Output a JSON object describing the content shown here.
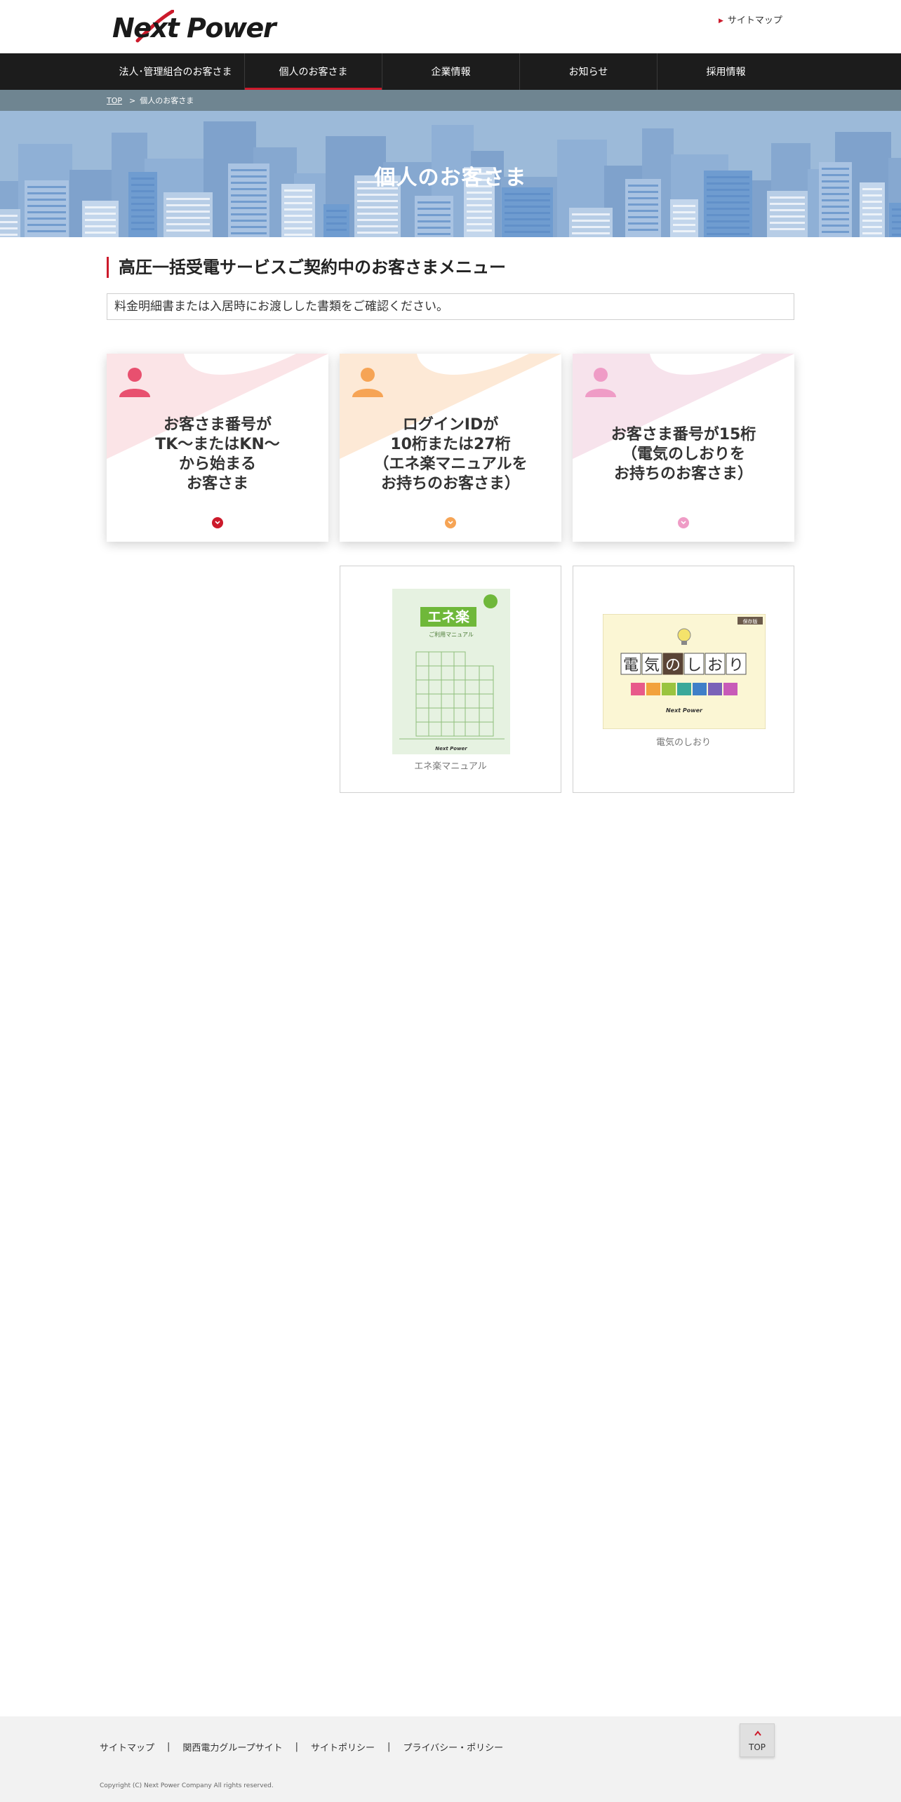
{
  "header": {
    "logo_text": "Next Power",
    "sitemap_label": "サイトマップ"
  },
  "gnav": {
    "items": [
      {
        "label": "法人･管理組合のお客さま"
      },
      {
        "label": "個人のお客さま",
        "active": true
      },
      {
        "label": "企業情報"
      },
      {
        "label": "お知らせ"
      },
      {
        "label": "採用情報"
      }
    ]
  },
  "breadcrumb": {
    "top": "TOP",
    "sep": ">",
    "current": "個人のお客さま"
  },
  "hero": {
    "title": "個人のお客さま"
  },
  "main": {
    "section_title": "高圧一括受電サービスご契約中のお客さまメニュー",
    "notice": "料金明細書または入居時にお渡しした書類をご確認ください。",
    "cards": [
      {
        "lines": [
          "お客さま番号が",
          "TK〜またはKN〜",
          "から始まる",
          "お客さま"
        ],
        "color": "#e8506f",
        "deco": "#fbe4e7"
      },
      {
        "lines": [
          "ログインIDが",
          "10桁または27桁",
          "（エネ楽マニュアルを",
          "お持ちのお客さま）"
        ],
        "color": "#f6a455",
        "deco": "#fde9d6"
      },
      {
        "lines": [
          "お客さま番号が15桁",
          "（電気のしおりを",
          "お持ちのお客さま）"
        ],
        "color": "#ef9cc6",
        "deco": "#f7e3ec"
      }
    ],
    "books": [
      {
        "caption": "エネ楽マニュアル",
        "cover_title": "エネ楽",
        "cover_subtitle": "ご利用マニュアル",
        "cover_brand": "Next Power"
      },
      {
        "caption": "電気のしおり",
        "cover_title": [
          "電",
          "気",
          "の",
          "し",
          "お",
          "り"
        ],
        "cover_badge": "保存版",
        "cover_brand": "Next Power"
      }
    ]
  },
  "footer": {
    "links": [
      "サイトマップ",
      "関西電力グループサイト",
      "サイトポリシー",
      "プライバシー・ポリシー"
    ],
    "copyright": "Copyright (C) Next Power Company All rights reserved.",
    "totop_label": "TOP"
  },
  "colors": {
    "accent": "#cc1a2b",
    "nav_bg": "#1c1c1c",
    "breadcrumb_bg": "#6f8591",
    "hero_bg": "#9cbad9",
    "footer_bg": "#f2f2f2"
  }
}
